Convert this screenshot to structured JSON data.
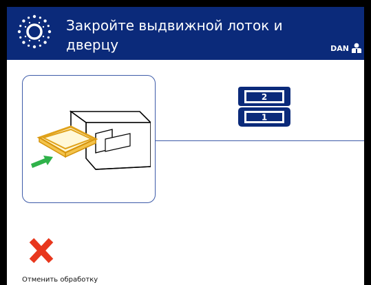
{
  "header": {
    "title_line1": "Закройте выдвижной лоток и",
    "title_line2": "дверцу",
    "user": "DAN",
    "background": "#0b2a7a"
  },
  "trays": {
    "upper": "2",
    "lower": "1",
    "color": "#0b2a7a"
  },
  "actions": {
    "cancel_label": "Отменить обработку",
    "cancel_color": "#e8371d"
  },
  "icons": {
    "logo": "sun-logo-icon",
    "user": "user-icon",
    "instrument": "instrument-drawer-icon",
    "cancel": "cancel-x-icon"
  }
}
